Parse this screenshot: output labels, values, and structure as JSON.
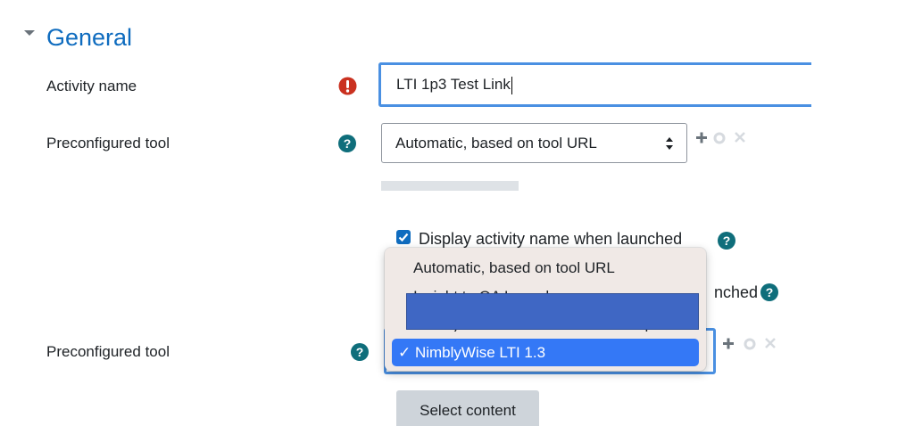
{
  "section": {
    "title": "General",
    "collapse_icon": "chevron-down-icon"
  },
  "activity_name": {
    "label": "Activity name",
    "value": "LTI 1p3 Test Link",
    "required_icon": "exclamation-circle-icon",
    "required_color": "#ca3120"
  },
  "preconfigured_tool": {
    "label": "Preconfigured tool",
    "selected": "Automatic, based on tool URL",
    "help_icon": "question-circle-icon"
  },
  "display_name_checkbox": {
    "label": "Display activity name when launched",
    "checked": true
  },
  "partial_label_suffix": "nched",
  "preconfigured_tool_2": {
    "label": "Preconfigured tool"
  },
  "dropdown": {
    "options": [
      "Automatic, based on tool URL",
      "Insight to QA Launch",
      "Nimbly Wise LTI 1.3 Launch Example",
      "NimblyWise LTI 1.3"
    ],
    "selected": "✓ NimblyWise LTI 1.3"
  },
  "select_content_button": "Select content",
  "colors": {
    "accent": "#0f6cbf",
    "help": "#0f6e7b",
    "focus": "#4a90e2",
    "highlight": "#3478f6",
    "redaction": "#3f67c4"
  }
}
